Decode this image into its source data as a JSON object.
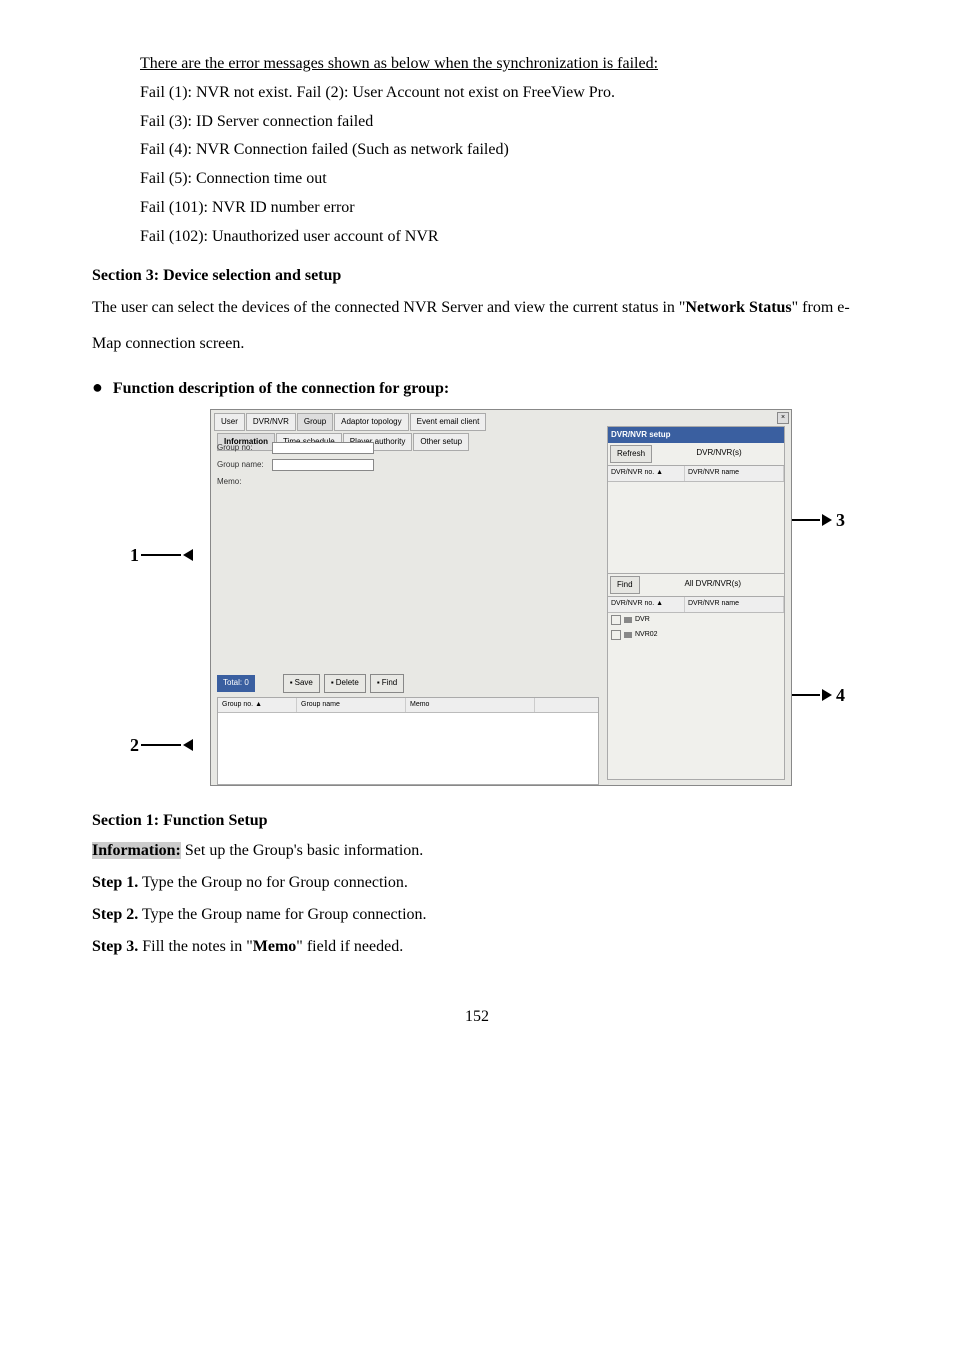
{
  "errors_header": "There are the error messages shown as below when the synchronization is failed:",
  "fails": {
    "f1": "Fail (1): NVR not exist.    Fail (2): User Account not exist on FreeView Pro.",
    "f3": "Fail (3): ID Server connection failed",
    "f4": "Fail (4): NVR Connection failed (Such as network failed)",
    "f5": "Fail (5): Connection time out",
    "f101": "Fail (101): NVR ID number error",
    "f102": "Fail (102): Unauthorized user account of NVR"
  },
  "section3_title": "Section 3: Device selection and setup",
  "section3_text_pre": "The user can select the devices of the connected NVR Server and view the current status in \"",
  "section3_bold": "Network Status",
  "section3_text_post": "\" from e-Map connection screen.",
  "function_desc": "Function description of the connection for group:",
  "section1_title": "Section 1: Function Setup",
  "info_label": "Information:",
  "info_text": " Set up the Group's basic information.",
  "step1_label": "Step 1.",
  "step1_text": "  Type the Group no for Group connection.",
  "step2_label": "Step 2.",
  "step2_text": "  Type the Group name for Group connection.",
  "step3_label": "Step 3.",
  "step3_text_pre": "  Fill the notes in \"",
  "step3_bold": "Memo",
  "step3_text_post": "\" field if needed.",
  "page_number": "152",
  "callouts": {
    "c1": "1",
    "c2": "2",
    "c3": "3",
    "c4": "4"
  },
  "dialog": {
    "tabs": {
      "user": "User",
      "dvrnvr": "DVR/NVR",
      "group": "Group",
      "adaptor": "Adaptor topology",
      "event": "Event email client"
    },
    "subtabs": {
      "info": "Information",
      "timesch": "Time schedule",
      "playauth": "Player authority",
      "other": "Other setup"
    },
    "form": {
      "groupno": "Group no:",
      "groupname": "Group name:",
      "memo": "Memo:"
    },
    "bottom": {
      "total": "Total:    0",
      "save": "Save",
      "delete": "Delete",
      "find": "Find"
    },
    "list_headers": {
      "groupno": "Group no. ▲",
      "groupname": "Group name",
      "memo": "Memo"
    },
    "right": {
      "title": "DVR/NVR setup",
      "refresh": "Refresh",
      "dvrnvrs": "DVR/NVR(s)",
      "col_no": "DVR/NVR no. ▲",
      "col_name": "DVR/NVR name",
      "find": "Find",
      "alldvr": "All DVR/NVR(s)",
      "item1": "DVR",
      "item2": "NVR02"
    },
    "close": "×"
  }
}
